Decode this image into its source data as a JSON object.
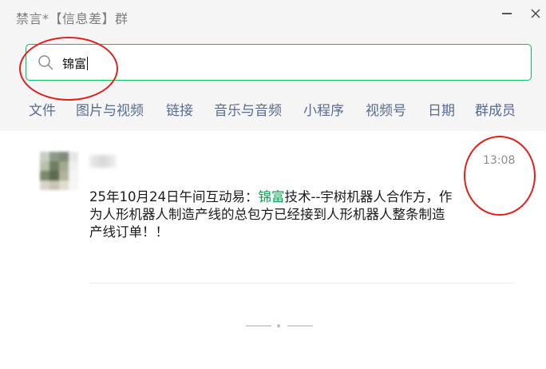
{
  "window": {
    "title": "禁言*【信息差】群",
    "minimize_icon": "minimize-icon",
    "close_icon": "close-icon"
  },
  "search": {
    "value": "锦富",
    "placeholder": "",
    "icon": "search-icon"
  },
  "tabs": [
    {
      "label": "文件"
    },
    {
      "label": "图片与视频"
    },
    {
      "label": "链接"
    },
    {
      "label": "音乐与音频"
    },
    {
      "label": "小程序"
    },
    {
      "label": "视频号"
    },
    {
      "label": "日期"
    },
    {
      "label": "群成员"
    }
  ],
  "result": {
    "time": "13:08",
    "message_before": "25年10月24日午间互动易：",
    "message_highlight": "锦富",
    "message_after": "技术--宇树机器人合作方，作为人形机器人制造产线的总包方已经接到人形机器人整条制造产线订单！！"
  },
  "colors": {
    "accent": "#07c160",
    "highlight": "#07a14e",
    "tab_text": "#576b95",
    "annotation": "#e0201c"
  }
}
